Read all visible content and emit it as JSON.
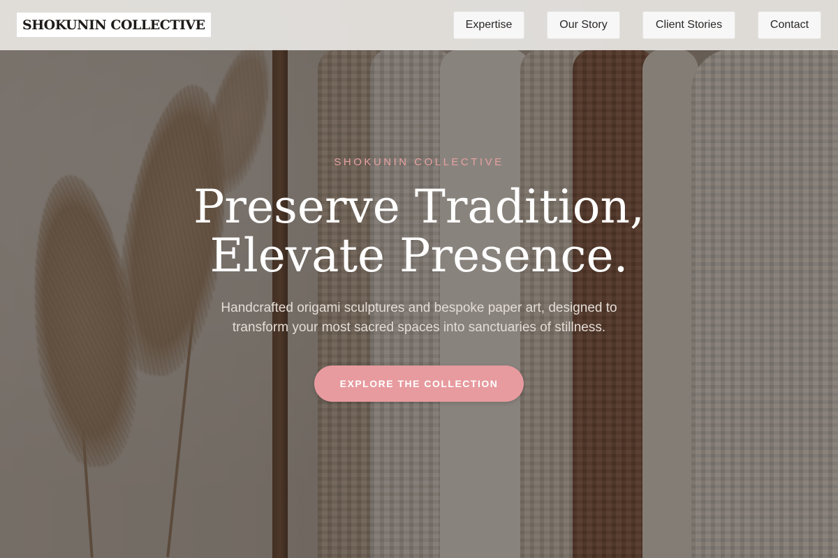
{
  "navbar": {
    "logo_text": "SHOKUNIN COLLECTIVE",
    "links": [
      {
        "label": "Expertise"
      },
      {
        "label": "Our Story"
      },
      {
        "label": "Client Stories"
      },
      {
        "label": "Contact"
      }
    ]
  },
  "hero": {
    "eyebrow": "SHOKUNIN COLLECTIVE",
    "headline_line1": "Preserve Tradition,",
    "headline_line2": "Elevate Presence.",
    "subtext_line1": "Handcrafted origami sculptures and bespoke paper art, designed to",
    "subtext_line2": "transform your most sacred spaces into sanctuaries of stillness.",
    "cta_label": "EXPLORE THE COLLECTION"
  },
  "colors": {
    "accent": "#e79b9f",
    "eyebrow": "#e7a1a1",
    "headline": "#ffffff",
    "navbar_bg": "#ebe9e6",
    "nav_button_bg": "#f7f7f7"
  }
}
